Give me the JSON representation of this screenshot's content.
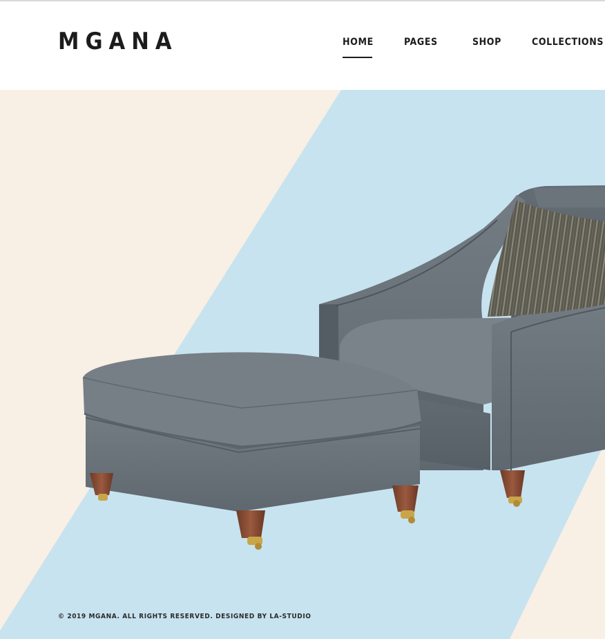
{
  "brand": {
    "logo_text": "MGANA"
  },
  "nav": {
    "items": [
      {
        "label": "HOME",
        "active": true
      },
      {
        "label": "PAGES",
        "active": false
      },
      {
        "label": "SHOP",
        "active": false
      },
      {
        "label": "COLLECTIONS",
        "active": false
      }
    ]
  },
  "hero": {
    "image_subject": "grey armchair with striped pillow and matching ottoman",
    "colors": {
      "cream": "#f8efe5",
      "light_blue": "#c7e3ef",
      "upholstery": "#6a727a"
    }
  },
  "footer": {
    "copyright": "© 2019 MGANA. ALL RIGHTS RESERVED. DESIGNED BY LA-STUDIO"
  }
}
